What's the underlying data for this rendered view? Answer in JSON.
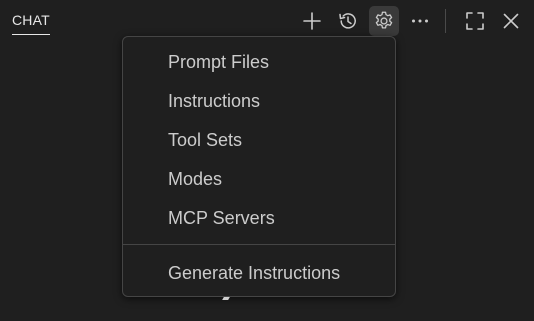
{
  "tabs": [
    {
      "label": "CHAT"
    }
  ],
  "toolbar": {
    "buttons": [
      {
        "icon": "plus-icon"
      },
      {
        "icon": "history-icon"
      },
      {
        "icon": "gear-icon"
      },
      {
        "icon": "ellipsis-icon"
      },
      {
        "icon": "maximize-icon"
      },
      {
        "icon": "close-icon"
      }
    ]
  },
  "menu": {
    "items": [
      {
        "label": "Prompt Files"
      },
      {
        "label": "Instructions"
      },
      {
        "label": "Tool Sets"
      },
      {
        "label": "Modes"
      },
      {
        "label": "MCP Servers"
      },
      {
        "label": "Generate Instructions"
      }
    ]
  },
  "colors": {
    "background": "#1f1f1f",
    "text": "#cccccc",
    "border": "#454545",
    "active_button": "#3a3a3a"
  }
}
